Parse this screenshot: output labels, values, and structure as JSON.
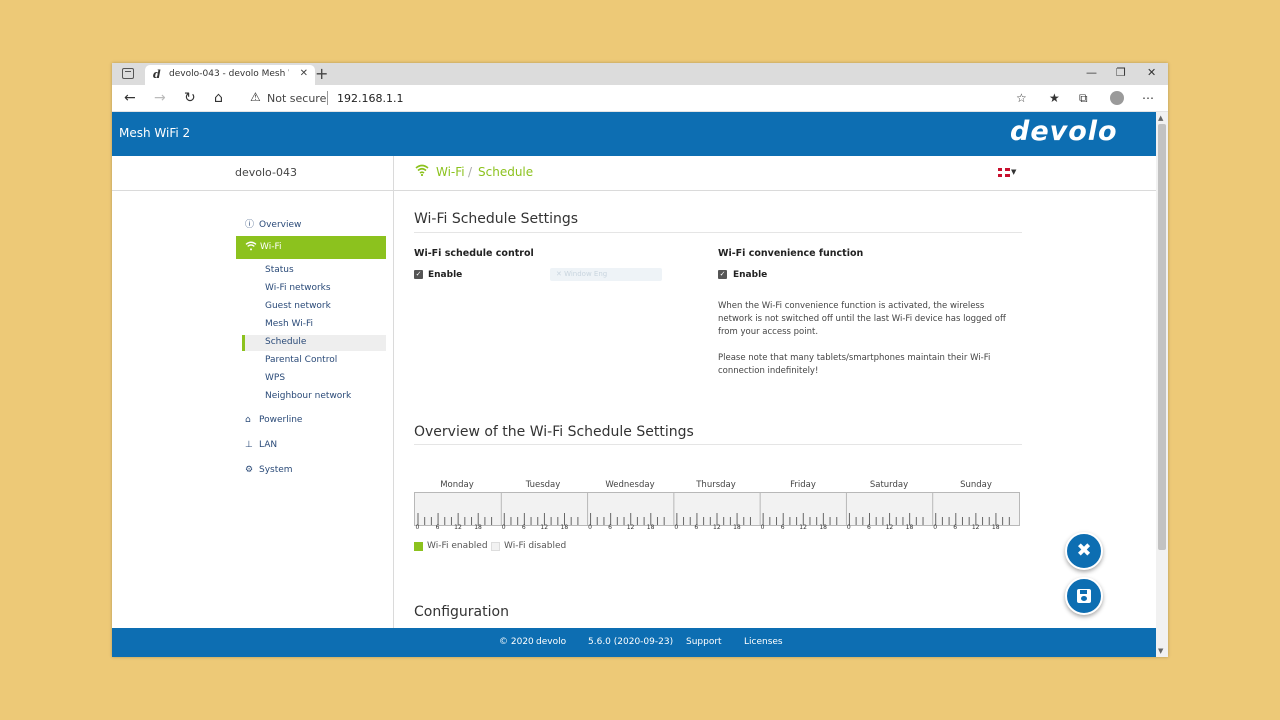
{
  "browser": {
    "tab_title": "devolo-043 - devolo Mesh WiFi 2",
    "tab_favicon": "d",
    "not_secure": "Not secure",
    "url": "192.168.1.1"
  },
  "header": {
    "title": "Mesh WiFi 2",
    "logo": "devolo"
  },
  "subheader": {
    "device_name": "devolo-043",
    "breadcrumb_section": "Wi-Fi",
    "breadcrumb_page": "Schedule"
  },
  "sidebar": {
    "overview": "Overview",
    "wifi": "Wi-Fi",
    "wifi_items": [
      "Status",
      "Wi-Fi networks",
      "Guest network",
      "Mesh Wi-Fi",
      "Schedule",
      "Parental Control",
      "WPS",
      "Neighbour network"
    ],
    "powerline": "Powerline",
    "lan": "LAN",
    "system": "System"
  },
  "schedule_settings": {
    "heading": "Wi-Fi Schedule Settings",
    "control_label": "Wi-Fi schedule control",
    "control_enable": "Enable",
    "convenience_label": "Wi-Fi convenience function",
    "convenience_enable": "Enable",
    "ghost_text": "Window Eng",
    "para1": "When the Wi-Fi convenience function is activated, the wireless network is not switched off until the last Wi-Fi device has logged off from your access point.",
    "para2": "Please note that many tablets/smartphones maintain their Wi-Fi connection indefinitely!"
  },
  "overview": {
    "heading": "Overview of the Wi-Fi Schedule Settings",
    "days": [
      "Monday",
      "Tuesday",
      "Wednesday",
      "Thursday",
      "Friday",
      "Saturday",
      "Sunday"
    ],
    "hour_labels": [
      "0",
      "6",
      "12",
      "18"
    ],
    "legend_enabled": "Wi-Fi enabled",
    "legend_disabled": "Wi-Fi disabled"
  },
  "configuration": {
    "heading": "Configuration"
  },
  "footer": {
    "copyright": "© 2020",
    "brand": "devolo",
    "version": "5.6.0 (2020-09-23)",
    "support": "Support",
    "licenses": "Licenses"
  },
  "colors": {
    "brand_blue": "#0d6eb2",
    "accent_green": "#8cc21e"
  }
}
